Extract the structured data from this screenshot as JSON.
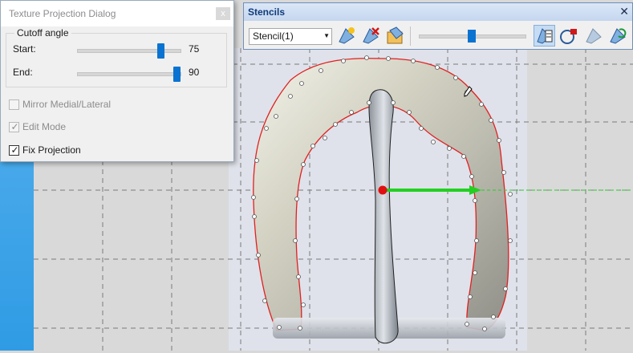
{
  "texture_dialog": {
    "title": "Texture Projection Dialog",
    "close_label": "x",
    "cutoff_group_label": "Cutoff angle",
    "start_label": "Start:",
    "start_value": "75",
    "end_label": "End:",
    "end_value": "90",
    "mirror_label": "Mirror Medial/Lateral",
    "edit_mode_label": "Edit Mode",
    "fix_projection_label": "Fix Projection",
    "mirror_checked": false,
    "edit_mode_checked": true,
    "fix_projection_checked": true
  },
  "stencils": {
    "title": "Stencils",
    "close_label": "✕",
    "selected_stencil": "Stencil(1)",
    "opacity_fraction": 0.5,
    "tools": [
      "add-stencil-icon",
      "delete-stencil-icon",
      "stencil-library-icon",
      "stencil-list-icon",
      "stencil-lock-icon",
      "stencil-hide-icon",
      "stencil-refresh-icon"
    ]
  },
  "colors": {
    "outline": "#e02020",
    "axis_arrow": "#22d022",
    "pivot": "#e01010",
    "accent": "#0a73d1",
    "left_strip": "#3aa4e8"
  }
}
